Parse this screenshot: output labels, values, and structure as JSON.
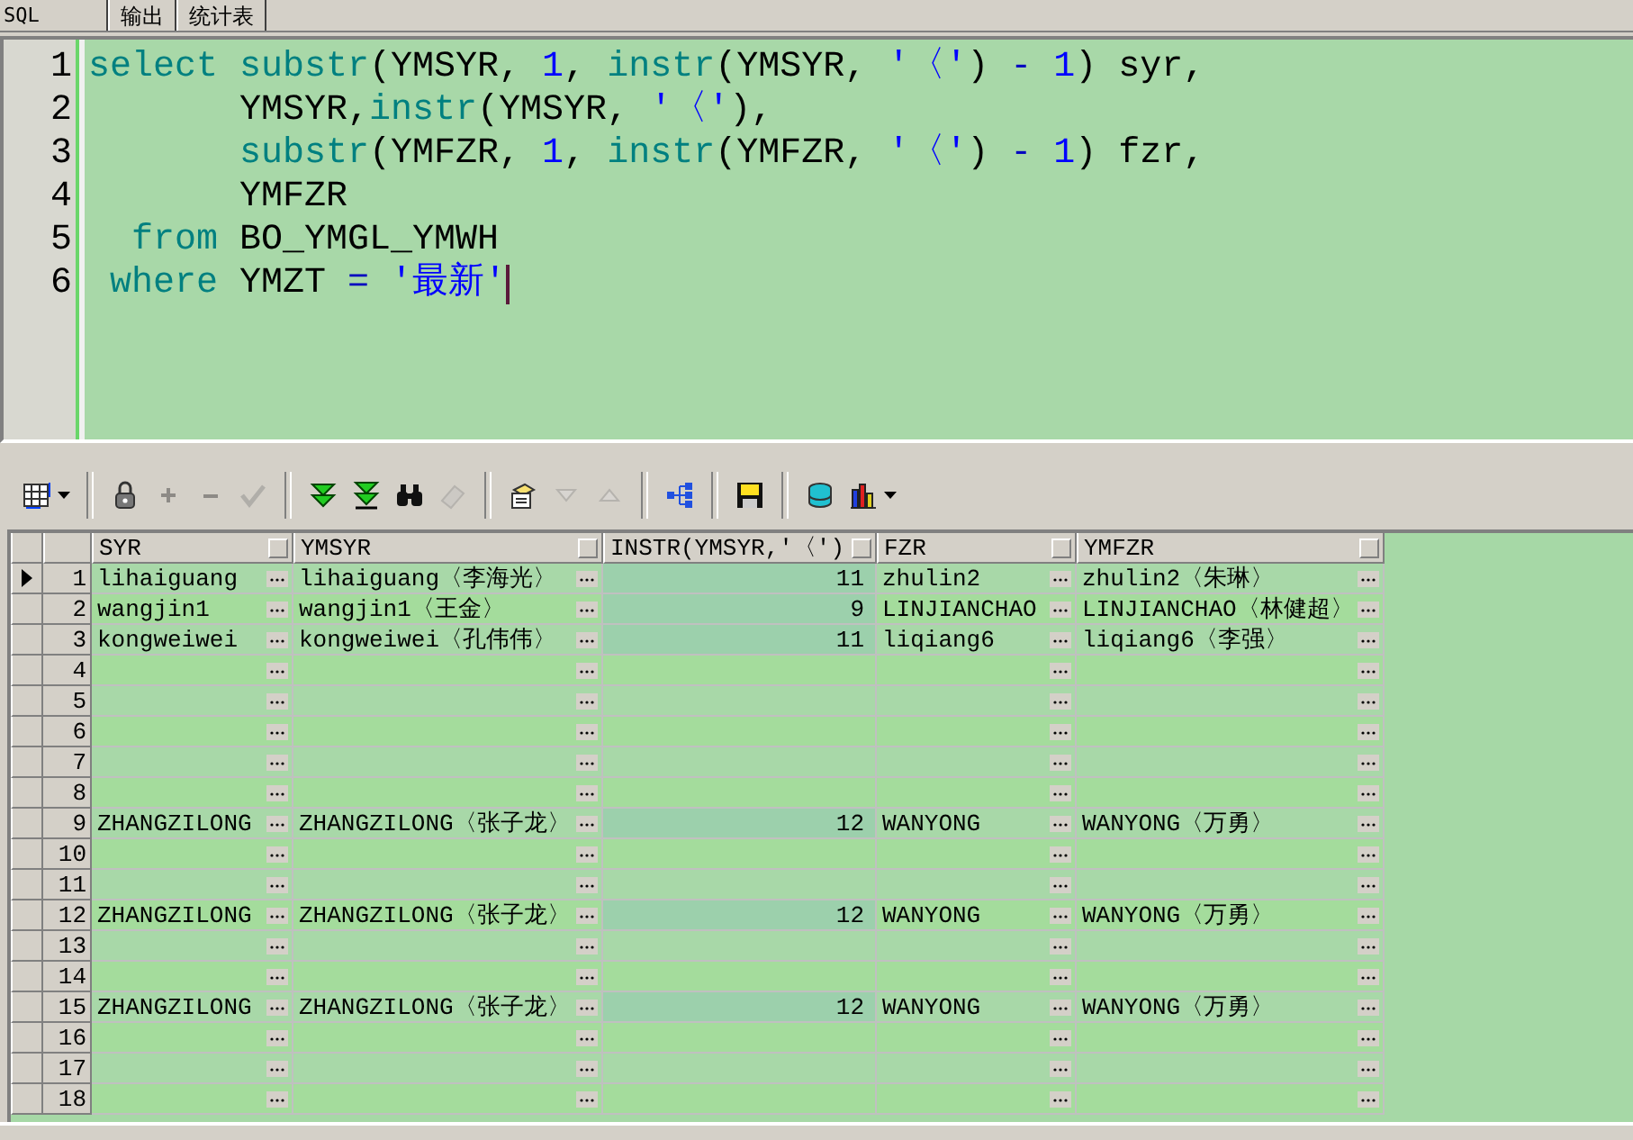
{
  "tabs": [
    {
      "label": "SQL",
      "selected": true
    },
    {
      "label": "输出",
      "selected": false
    },
    {
      "label": "统计表",
      "selected": false
    }
  ],
  "editor": {
    "lines": [
      {
        "number": "1",
        "tokens": [
          {
            "t": "select ",
            "kind": "keyword"
          },
          {
            "t": "substr",
            "kind": "function"
          },
          {
            "t": "(YMSYR, ",
            "kind": "plain"
          },
          {
            "t": "1",
            "kind": "number"
          },
          {
            "t": ", ",
            "kind": "plain"
          },
          {
            "t": "instr",
            "kind": "function"
          },
          {
            "t": "(YMSYR, ",
            "kind": "plain"
          },
          {
            "t": "'〈'",
            "kind": "string"
          },
          {
            "t": ") ",
            "kind": "plain"
          },
          {
            "t": "- ",
            "kind": "operator"
          },
          {
            "t": "1",
            "kind": "number"
          },
          {
            "t": ") syr,",
            "kind": "plain"
          }
        ]
      },
      {
        "number": "2",
        "tokens": [
          {
            "t": "       YMSYR,",
            "kind": "plain"
          },
          {
            "t": "instr",
            "kind": "function"
          },
          {
            "t": "(YMSYR, ",
            "kind": "plain"
          },
          {
            "t": "'〈'",
            "kind": "string"
          },
          {
            "t": "),",
            "kind": "plain"
          }
        ]
      },
      {
        "number": "3",
        "tokens": [
          {
            "t": "       substr",
            "kind": "function"
          },
          {
            "t": "(YMFZR, ",
            "kind": "plain"
          },
          {
            "t": "1",
            "kind": "number"
          },
          {
            "t": ", ",
            "kind": "plain"
          },
          {
            "t": "instr",
            "kind": "function"
          },
          {
            "t": "(YMFZR, ",
            "kind": "plain"
          },
          {
            "t": "'〈'",
            "kind": "string"
          },
          {
            "t": ") ",
            "kind": "plain"
          },
          {
            "t": "- ",
            "kind": "operator"
          },
          {
            "t": "1",
            "kind": "number"
          },
          {
            "t": ") fzr,",
            "kind": "plain"
          }
        ]
      },
      {
        "number": "4",
        "tokens": [
          {
            "t": "       YMFZR",
            "kind": "plain"
          }
        ]
      },
      {
        "number": "5",
        "tokens": [
          {
            "t": "  from",
            "kind": "keyword"
          },
          {
            "t": " BO_YMGL_YMWH",
            "kind": "plain"
          }
        ]
      },
      {
        "number": "6",
        "tokens": [
          {
            "t": " where",
            "kind": "keyword"
          },
          {
            "t": " YMZT ",
            "kind": "plain"
          },
          {
            "t": "= ",
            "kind": "operator"
          },
          {
            "t": "'最新'",
            "kind": "string"
          }
        ],
        "cursor": true
      }
    ]
  },
  "toolbar": [
    {
      "kind": "grid",
      "disabled": false,
      "dropdown": true
    },
    {
      "kind": "separator"
    },
    {
      "kind": "lock",
      "disabled": false
    },
    {
      "kind": "plus",
      "disabled": true
    },
    {
      "kind": "minus",
      "disabled": true
    },
    {
      "kind": "check",
      "disabled": true
    },
    {
      "kind": "separator"
    },
    {
      "kind": "fetch-next",
      "disabled": false
    },
    {
      "kind": "fetch-last",
      "disabled": false
    },
    {
      "kind": "find",
      "disabled": false
    },
    {
      "kind": "clear",
      "disabled": true
    },
    {
      "kind": "separator"
    },
    {
      "kind": "documents",
      "disabled": false
    },
    {
      "kind": "sort-down",
      "disabled": true
    },
    {
      "kind": "sort-up",
      "disabled": true
    },
    {
      "kind": "separator"
    },
    {
      "kind": "tree",
      "disabled": false
    },
    {
      "kind": "separator"
    },
    {
      "kind": "save",
      "disabled": false
    },
    {
      "kind": "separator"
    },
    {
      "kind": "database",
      "disabled": false
    },
    {
      "kind": "chart",
      "disabled": false,
      "dropdown": true
    }
  ],
  "grid": {
    "columns": [
      {
        "label": "SYR",
        "kind": "text"
      },
      {
        "label": "YMSYR",
        "kind": "text"
      },
      {
        "label": "INSTR(YMSYR,'〈')",
        "kind": "number"
      },
      {
        "label": "FZR",
        "kind": "text"
      },
      {
        "label": "YMFZR",
        "kind": "text"
      }
    ],
    "rows": [
      {
        "number": "1",
        "current": true,
        "cells": [
          "lihaiguang",
          "lihaiguang〈李海光〉",
          "11",
          "zhulin2",
          "zhulin2〈朱琳〉"
        ]
      },
      {
        "number": "2",
        "current": false,
        "cells": [
          "wangjin1",
          "wangjin1〈王金〉",
          "9",
          "LINJIANCHAO",
          "LINJIANCHAO〈林健超〉"
        ]
      },
      {
        "number": "3",
        "current": false,
        "cells": [
          "kongweiwei",
          "kongweiwei〈孔伟伟〉",
          "11",
          "liqiang6",
          "liqiang6〈李强〉"
        ]
      },
      {
        "number": "4",
        "current": false,
        "cells": [
          null,
          null,
          null,
          null,
          null
        ]
      },
      {
        "number": "5",
        "current": false,
        "cells": [
          null,
          null,
          null,
          null,
          null
        ]
      },
      {
        "number": "6",
        "current": false,
        "cells": [
          null,
          null,
          null,
          null,
          null
        ]
      },
      {
        "number": "7",
        "current": false,
        "cells": [
          null,
          null,
          null,
          null,
          null
        ]
      },
      {
        "number": "8",
        "current": false,
        "cells": [
          null,
          null,
          null,
          null,
          null
        ]
      },
      {
        "number": "9",
        "current": false,
        "cells": [
          "ZHANGZILONG",
          "ZHANGZILONG〈张子龙〉",
          "12",
          "WANYONG",
          "WANYONG〈万勇〉"
        ]
      },
      {
        "number": "10",
        "current": false,
        "cells": [
          null,
          null,
          null,
          null,
          null
        ]
      },
      {
        "number": "11",
        "current": false,
        "cells": [
          null,
          null,
          null,
          null,
          null
        ]
      },
      {
        "number": "12",
        "current": false,
        "cells": [
          "ZHANGZILONG",
          "ZHANGZILONG〈张子龙〉",
          "12",
          "WANYONG",
          "WANYONG〈万勇〉"
        ]
      },
      {
        "number": "13",
        "current": false,
        "cells": [
          null,
          null,
          null,
          null,
          null
        ]
      },
      {
        "number": "14",
        "current": false,
        "cells": [
          null,
          null,
          null,
          null,
          null
        ]
      },
      {
        "number": "15",
        "current": false,
        "cells": [
          "ZHANGZILONG",
          "ZHANGZILONG〈张子龙〉",
          "12",
          "WANYONG",
          "WANYONG〈万勇〉"
        ]
      },
      {
        "number": "16",
        "current": false,
        "cells": [
          null,
          null,
          null,
          null,
          null
        ]
      },
      {
        "number": "17",
        "current": false,
        "cells": [
          null,
          null,
          null,
          null,
          null
        ]
      },
      {
        "number": "18",
        "current": false,
        "cells": [
          null,
          null,
          null,
          null,
          null
        ]
      }
    ]
  }
}
